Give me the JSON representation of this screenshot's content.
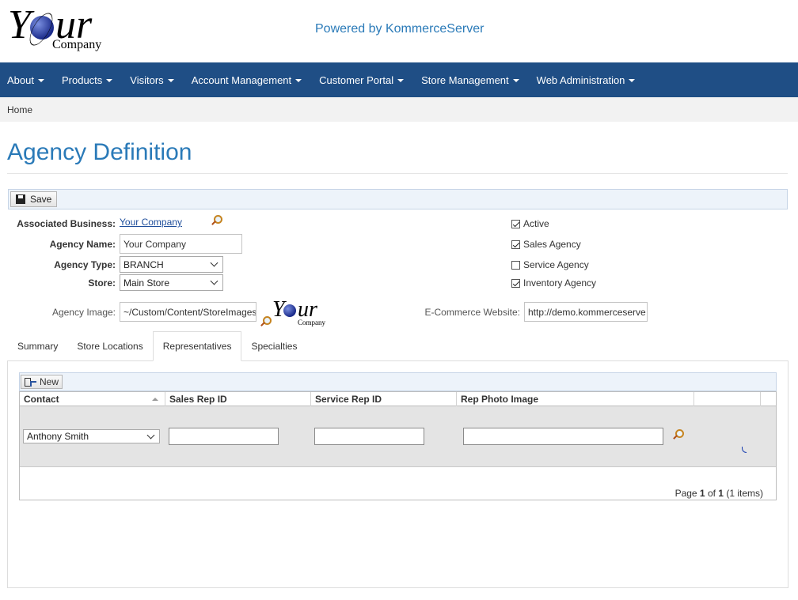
{
  "header": {
    "logo_text": "Your Company",
    "powered_by": "Powered by KommerceServer"
  },
  "nav": {
    "items": [
      {
        "label": "About"
      },
      {
        "label": "Products"
      },
      {
        "label": "Visitors"
      },
      {
        "label": "Account Management"
      },
      {
        "label": "Customer Portal"
      },
      {
        "label": "Store Management"
      },
      {
        "label": "Web Administration"
      }
    ]
  },
  "breadcrumb": {
    "home": "Home"
  },
  "page": {
    "title": "Agency Definition"
  },
  "toolbar": {
    "save_label": "Save"
  },
  "form": {
    "associated_business_label": "Associated Business:",
    "associated_business_value": "Your Company",
    "agency_name_label": "Agency Name:",
    "agency_name_value": "Your Company",
    "agency_type_label": "Agency Type:",
    "agency_type_value": "BRANCH",
    "store_label": "Store:",
    "store_value": "Main Store",
    "agency_image_label": "Agency Image:",
    "agency_image_value": "~/Custom/Content/StoreImages",
    "ecommerce_label": "E-Commerce Website:",
    "ecommerce_value": "http://demo.kommerceserve",
    "checkboxes": [
      {
        "label": "Active",
        "checked": true
      },
      {
        "label": "Sales Agency",
        "checked": true
      },
      {
        "label": "Service Agency",
        "checked": false
      },
      {
        "label": "Inventory Agency",
        "checked": true
      }
    ]
  },
  "tabs": [
    {
      "label": "Summary",
      "active": false
    },
    {
      "label": "Store Locations",
      "active": false
    },
    {
      "label": "Representatives",
      "active": true
    },
    {
      "label": "Specialties",
      "active": false
    }
  ],
  "grid": {
    "new_label": "New",
    "columns": [
      "Contact",
      "Sales Rep ID",
      "Service Rep ID",
      "Rep Photo Image"
    ],
    "rows": [
      {
        "contact": "Anthony Smith",
        "sales_rep_id": "",
        "service_rep_id": "",
        "rep_photo_image": ""
      }
    ],
    "pager": {
      "prefix": "Page ",
      "page": "1",
      "of": " of ",
      "total": "1",
      "items": " (1 items)"
    }
  }
}
